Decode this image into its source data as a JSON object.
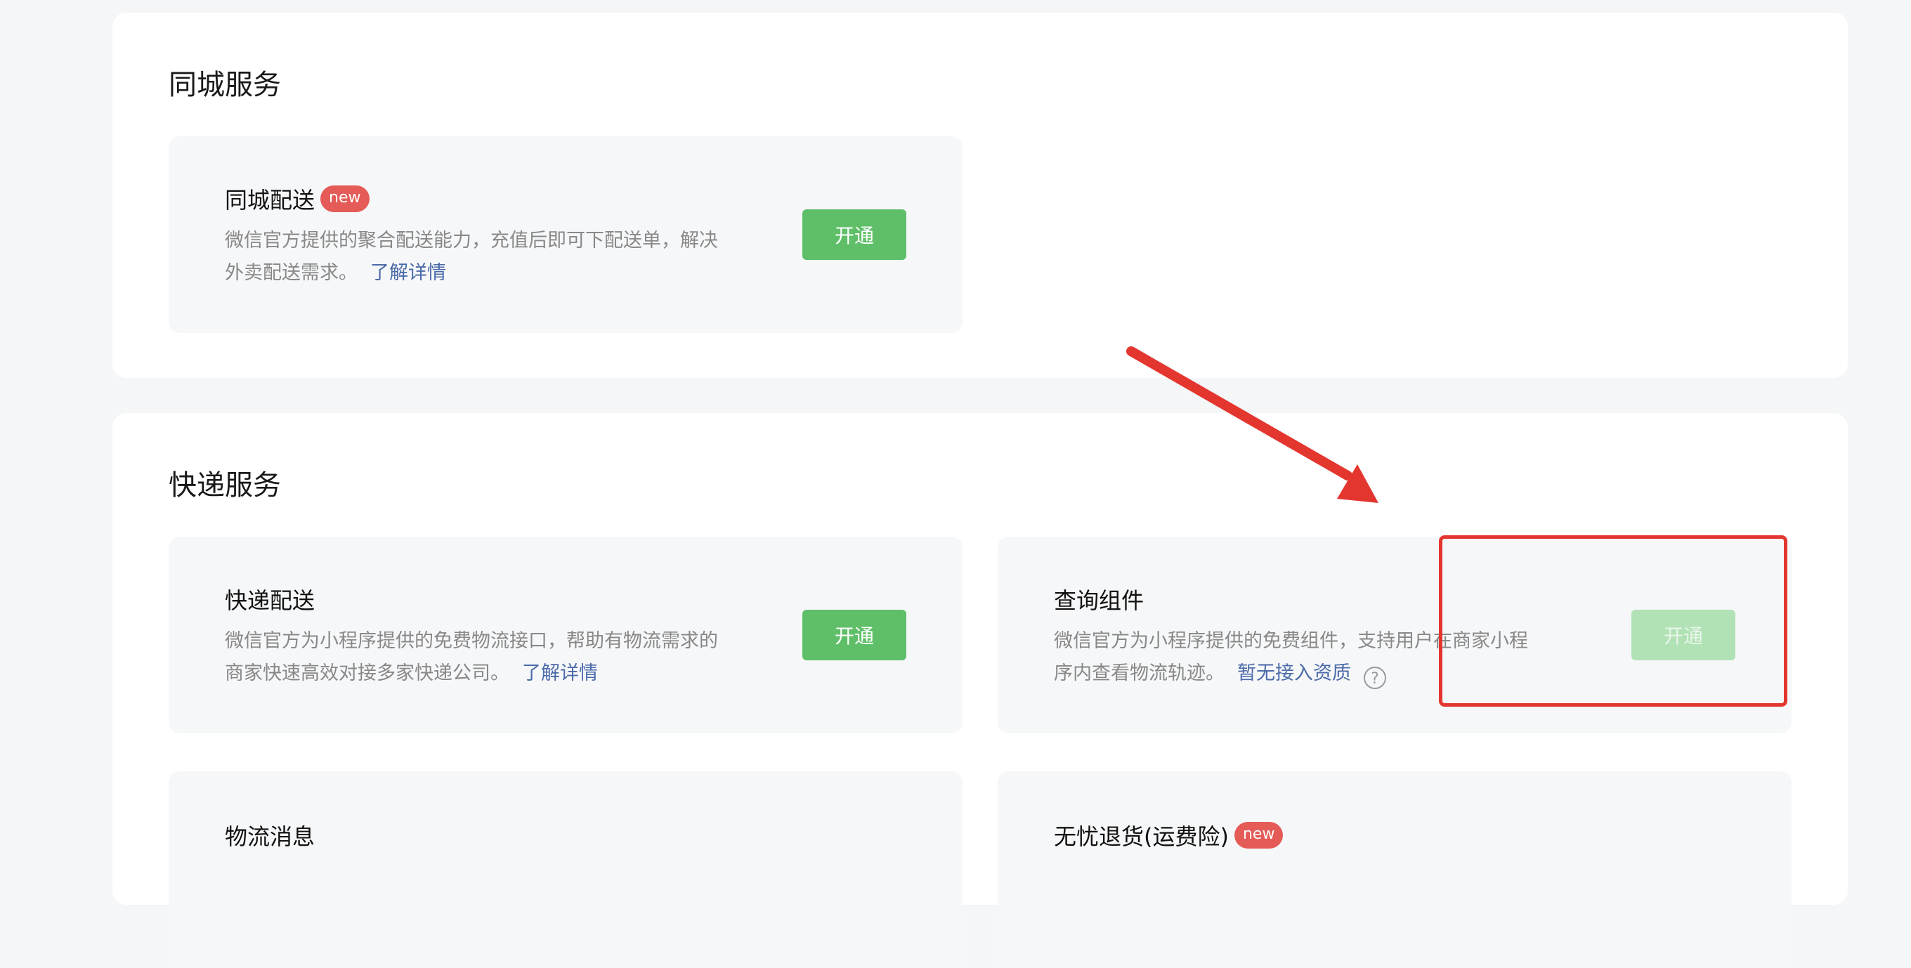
{
  "local_service": {
    "title": "同城服务",
    "card": {
      "title": "同城配送",
      "badge": "new",
      "desc": "微信官方提供的聚合配送能力，充值后即可下配送单，解决外卖配送需求。",
      "link": "了解详情",
      "button": "开通"
    }
  },
  "express_service": {
    "title": "快递服务",
    "cards": [
      {
        "title": "快递配送",
        "desc": "微信官方为小程序提供的免费物流接口，帮助有物流需求的商家快速高效对接多家快递公司。",
        "link": "了解详情",
        "button": "开通"
      },
      {
        "title": "查询组件",
        "desc": "微信官方为小程序提供的免费组件，支持用户在商家小程序内查看物流轨迹。",
        "link": "暂无接入资质",
        "help_icon": "?",
        "button": "开通",
        "button_state": "disabled"
      },
      {
        "title": "物流消息"
      },
      {
        "title": "无忧退货(运费险)",
        "badge": "new"
      }
    ]
  },
  "colors": {
    "accent_green": "#5fbf68",
    "disabled_green": "#b1e2b5",
    "link_blue": "#4a6aa8",
    "badge_red": "#e45b57",
    "annotation_red": "#e3362f"
  }
}
